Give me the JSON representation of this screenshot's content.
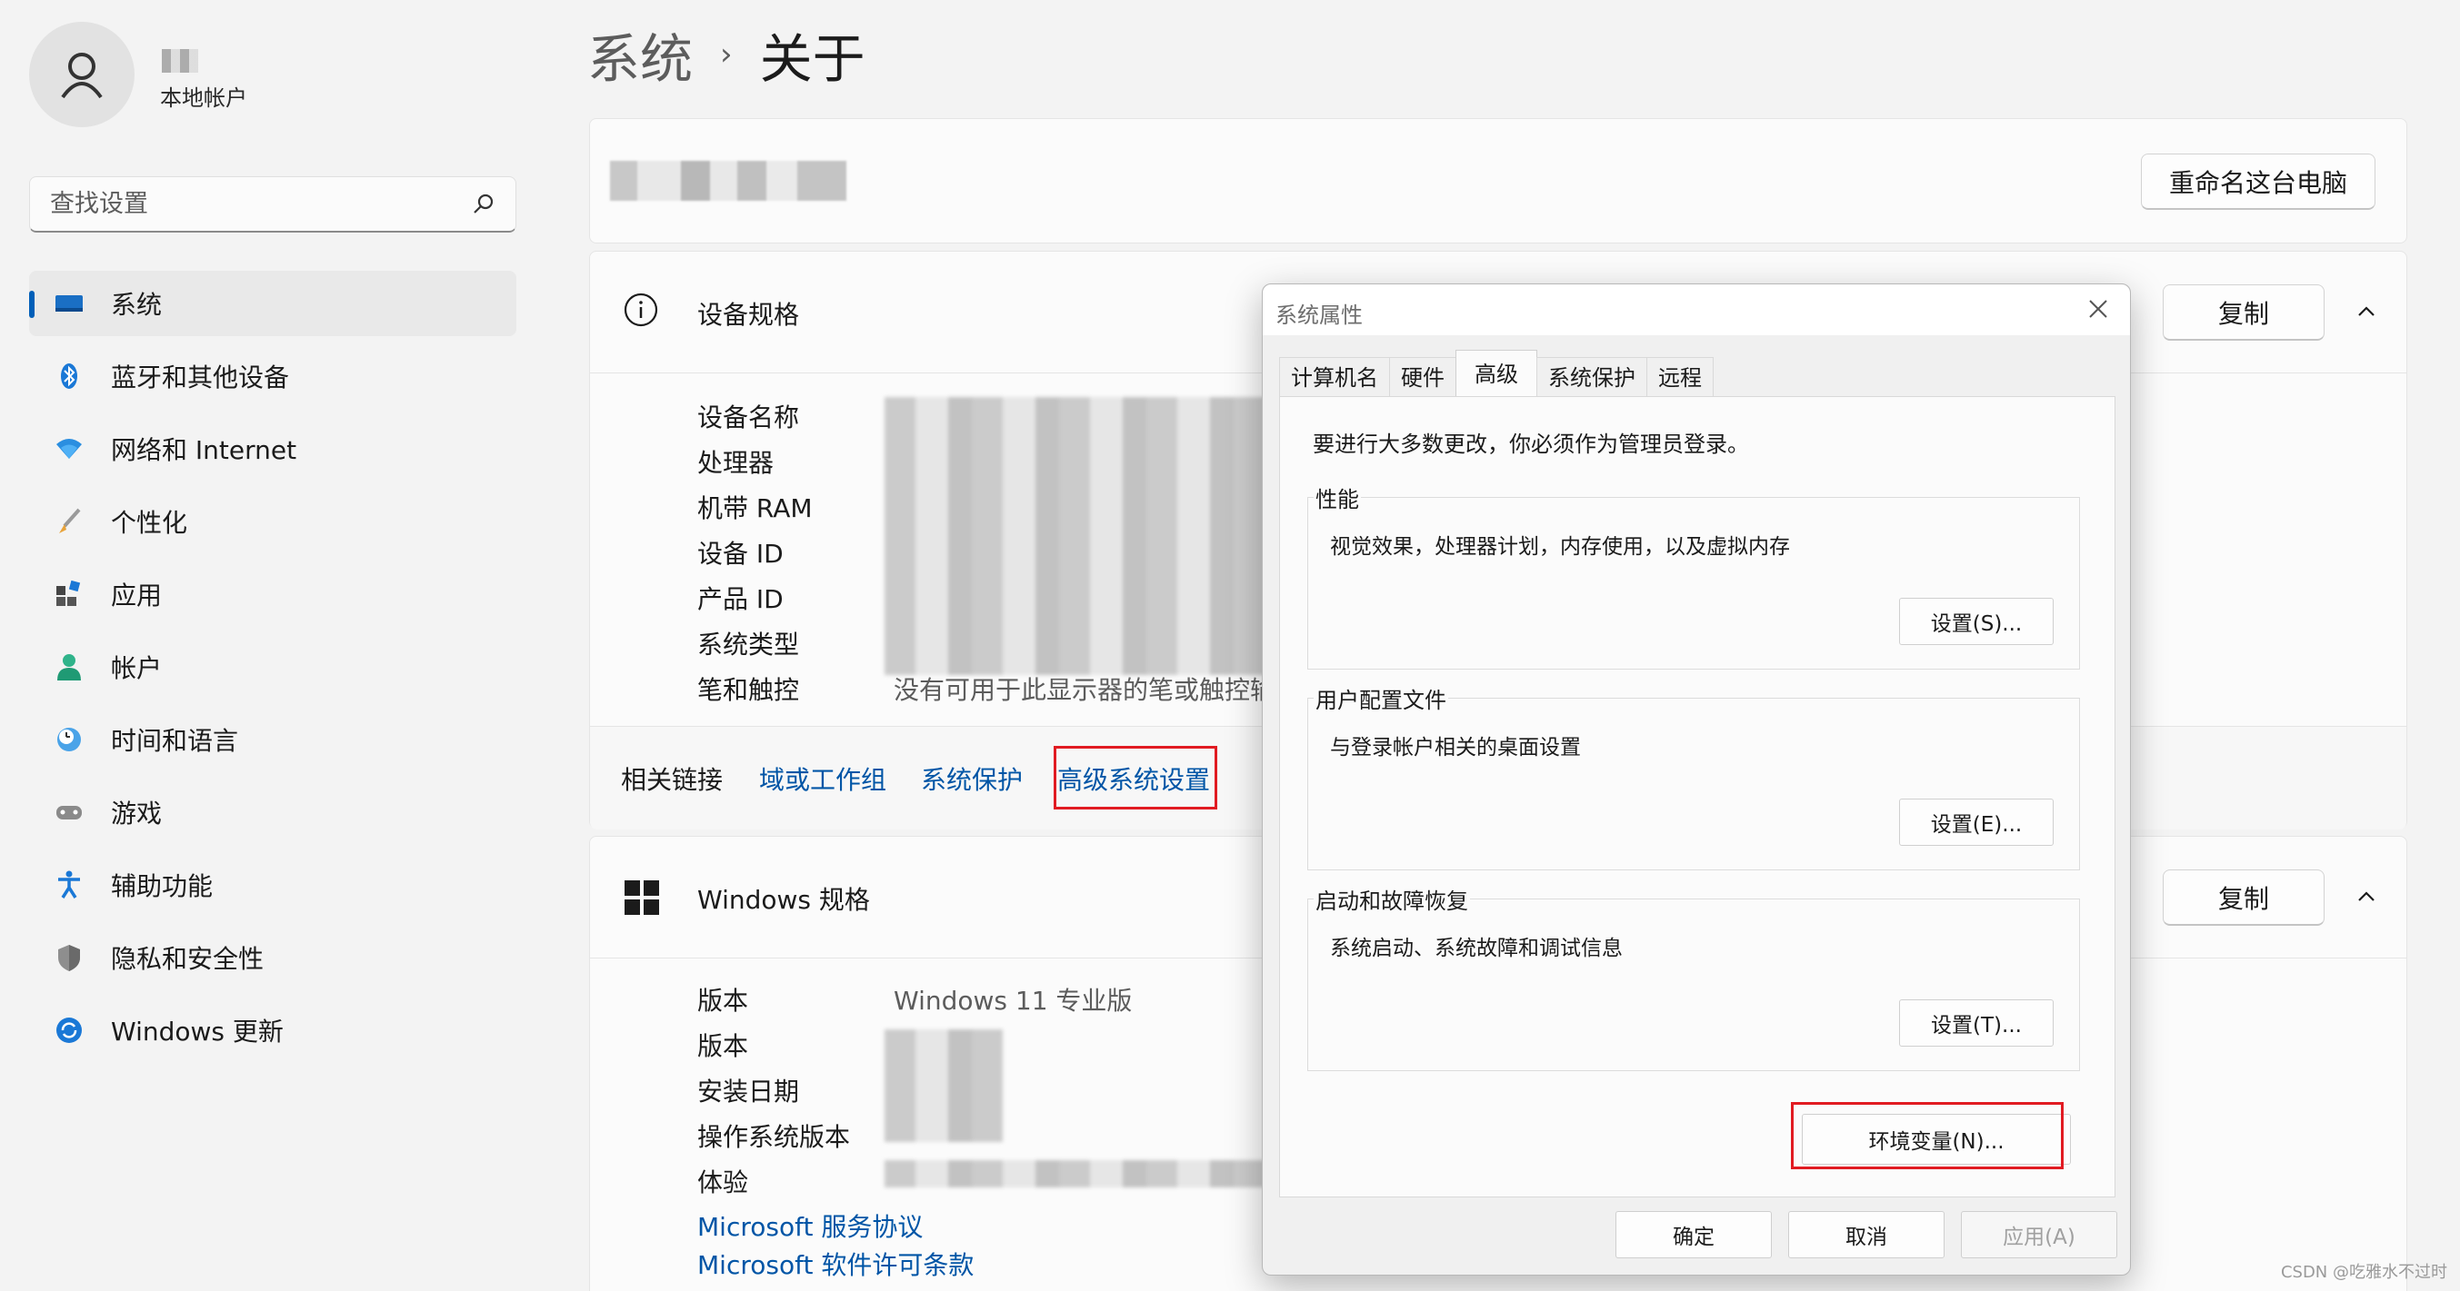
{
  "user": {
    "account_type": "本地帐户"
  },
  "search": {
    "placeholder": "查找设置"
  },
  "sidebar": {
    "items": [
      {
        "label": "系统",
        "icon": "display-icon"
      },
      {
        "label": "蓝牙和其他设备",
        "icon": "bluetooth-icon"
      },
      {
        "label": "网络和 Internet",
        "icon": "wifi-icon"
      },
      {
        "label": "个性化",
        "icon": "brush-icon"
      },
      {
        "label": "应用",
        "icon": "apps-icon"
      },
      {
        "label": "帐户",
        "icon": "person-icon"
      },
      {
        "label": "时间和语言",
        "icon": "globe-clock-icon"
      },
      {
        "label": "游戏",
        "icon": "gamepad-icon"
      },
      {
        "label": "辅助功能",
        "icon": "accessibility-icon"
      },
      {
        "label": "隐私和安全性",
        "icon": "shield-icon"
      },
      {
        "label": "Windows 更新",
        "icon": "update-icon"
      }
    ]
  },
  "breadcrumb": {
    "parent": "系统",
    "separator": "›",
    "current": "关于"
  },
  "pc_card": {
    "rename_label": "重命名这台电脑"
  },
  "device_specs": {
    "title": "设备规格",
    "copy_label": "复制",
    "rows": [
      {
        "label": "设备名称",
        "value": ""
      },
      {
        "label": "处理器",
        "value": ""
      },
      {
        "label": "机带 RAM",
        "value": ""
      },
      {
        "label": "设备 ID",
        "value": ""
      },
      {
        "label": "产品 ID",
        "value": ""
      },
      {
        "label": "系统类型",
        "value": ""
      },
      {
        "label": "笔和触控",
        "value": "没有可用于此显示器的笔或触控输"
      }
    ]
  },
  "related_links": {
    "label": "相关链接",
    "links": [
      "域或工作组",
      "系统保护",
      "高级系统设置"
    ]
  },
  "windows_specs": {
    "title": "Windows 规格",
    "copy_label": "复制",
    "rows": [
      {
        "label": "版本",
        "value": "Windows 11 专业版"
      },
      {
        "label": "版本",
        "value": ""
      },
      {
        "label": "安装日期",
        "value": ""
      },
      {
        "label": "操作系统版本",
        "value": ""
      },
      {
        "label": "体验",
        "value": ""
      }
    ],
    "links": [
      "Microsoft 服务协议",
      "Microsoft 软件许可条款"
    ]
  },
  "dialog": {
    "title": "系统属性",
    "tabs": [
      "计算机名",
      "硬件",
      "高级",
      "系统保护",
      "远程"
    ],
    "active_tab": "高级",
    "note": "要进行大多数更改，你必须作为管理员登录。",
    "groups": [
      {
        "title": "性能",
        "desc": "视觉效果，处理器计划，内存使用，以及虚拟内存",
        "button": "设置(S)..."
      },
      {
        "title": "用户配置文件",
        "desc": "与登录帐户相关的桌面设置",
        "button": "设置(E)..."
      },
      {
        "title": "启动和故障恢复",
        "desc": "系统启动、系统故障和调试信息",
        "button": "设置(T)..."
      }
    ],
    "env_button": "环境变量(N)...",
    "ok": "确定",
    "cancel": "取消",
    "apply": "应用(A)"
  },
  "watermark": "CSDN @吃雅水不过时",
  "colors": {
    "accent": "#005fb8",
    "link": "#0055a6",
    "highlight": "#e11b22"
  }
}
